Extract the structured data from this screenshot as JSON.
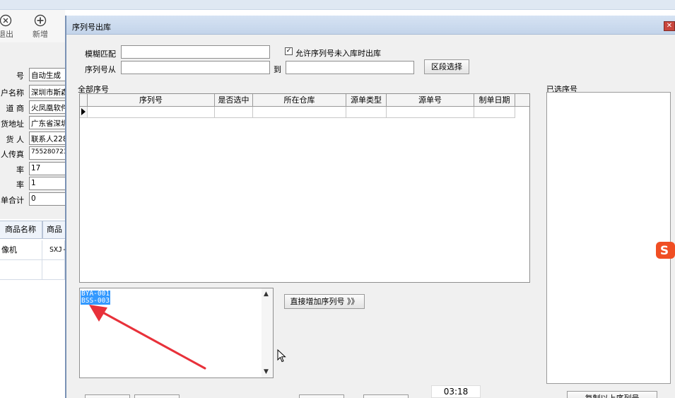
{
  "background_window": {
    "toolbar": [
      {
        "label": "退出",
        "icon": "exit-icon"
      },
      {
        "label": "新增",
        "icon": "add-icon"
      }
    ],
    "form": [
      {
        "label": "号",
        "value": "自动生成"
      },
      {
        "label": "户名称",
        "value": "深圳市斯森"
      },
      {
        "label": "道 商",
        "value": "火凤凰软件"
      },
      {
        "label": "货地址",
        "value": "广东省深圳"
      },
      {
        "label": "货 人",
        "value": "联系人228"
      },
      {
        "label": "人传真",
        "value": "755280723"
      },
      {
        "label": "率",
        "value": "17"
      },
      {
        "label": "率",
        "value": "1"
      },
      {
        "label": "单合计",
        "value": "0"
      }
    ],
    "grid": {
      "headers": [
        "商品名称",
        "商品"
      ],
      "rows": [
        [
          "像机",
          "SXJ-"
        ]
      ]
    }
  },
  "dialog": {
    "title": "序列号出库",
    "fuzzy_label": "模糊匹配",
    "fuzzy_value": "",
    "allow_checkbox_label": "允许序列号未入库时出库",
    "allow_checked": true,
    "from_label": "序列号从",
    "from_value": "",
    "to_label": "到",
    "to_value": "",
    "range_button": "区段选择",
    "all_group_label": "全部序号",
    "selected_group_label": "已选序号",
    "grid_columns": [
      "序列号",
      "是否选中",
      "所在仓库",
      "源单类型",
      "源单号",
      "制单日期"
    ],
    "serial_lines": [
      "BYA-001",
      "BSS-003"
    ],
    "add_button": "直接增加序列号 》》",
    "copy_button": "复制以上序列号"
  },
  "taskbar": {
    "time": "03:18"
  },
  "colors": {
    "selection": "#3399ff",
    "annotation_arrow": "#e8313a",
    "sogou_badge": "#f04e23"
  }
}
